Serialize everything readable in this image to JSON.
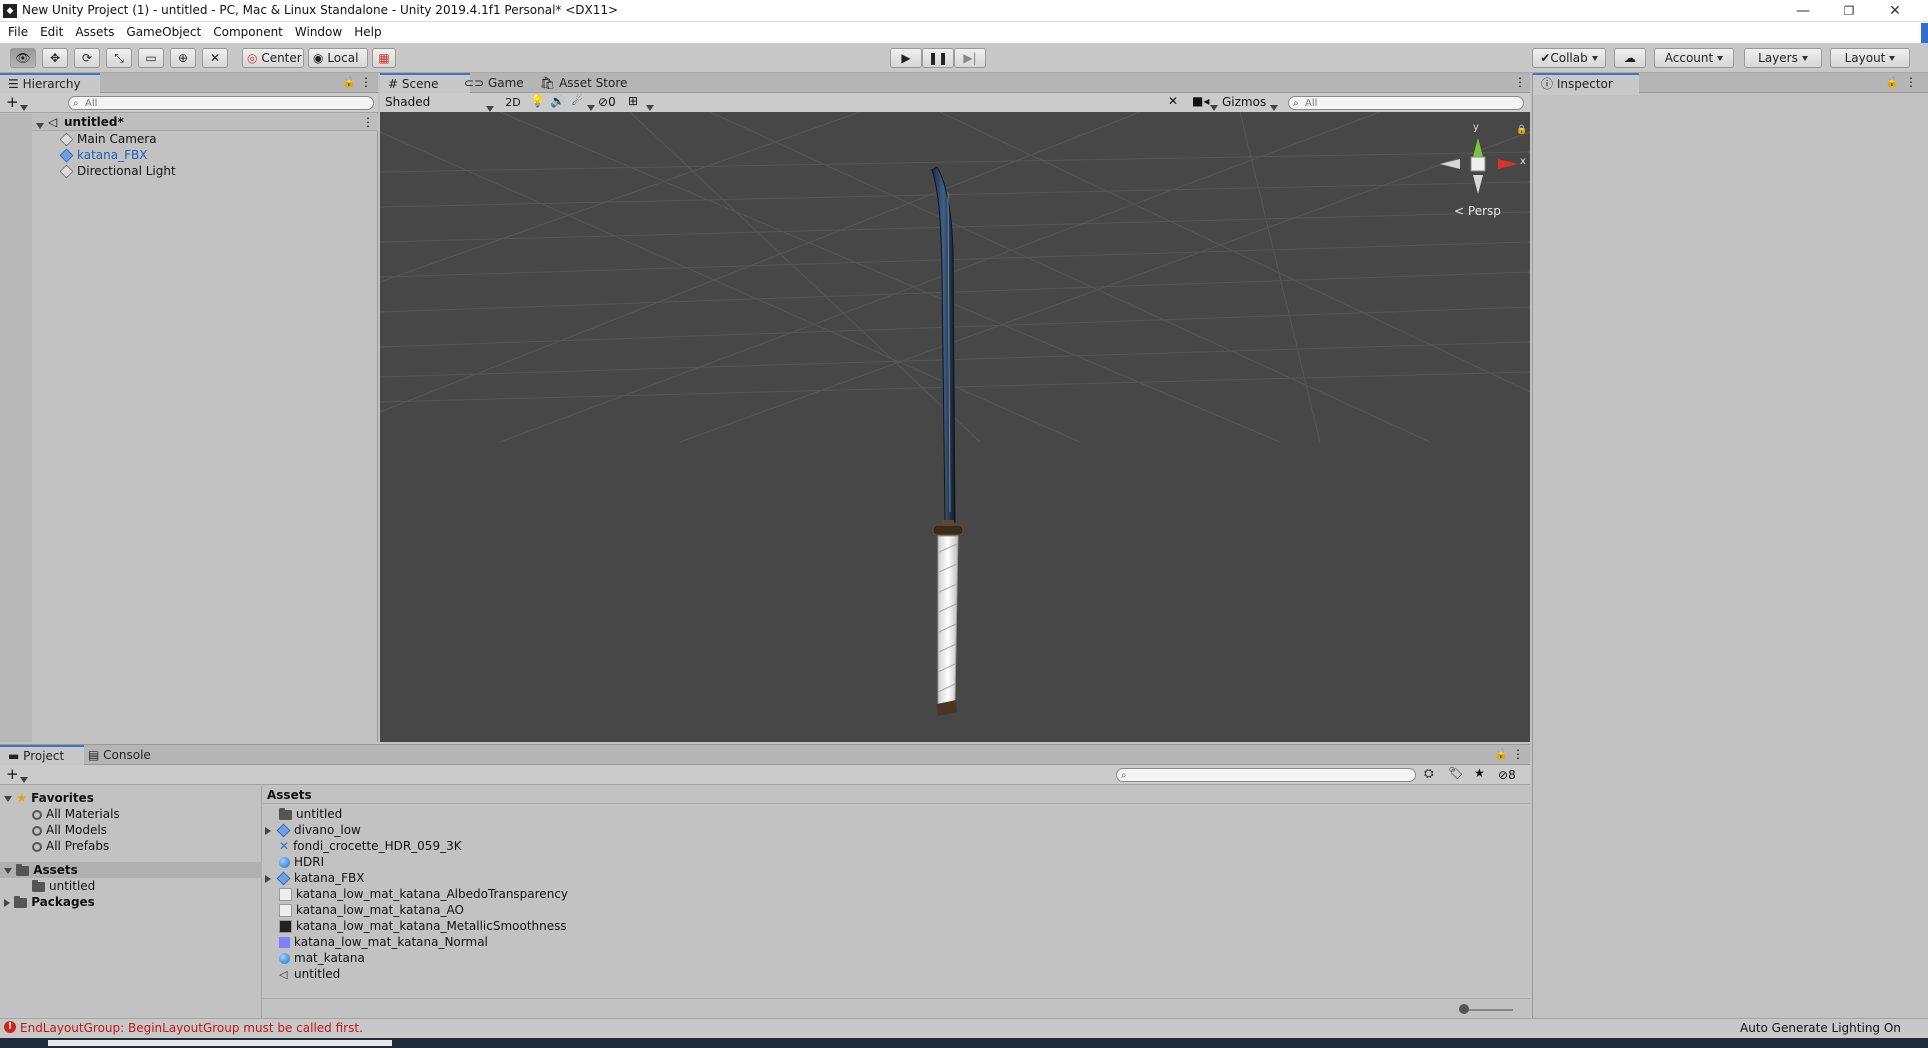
{
  "window": {
    "title": "New Unity Project (1) - untitled - PC, Mac & Linux Standalone - Unity 2019.4.1f1 Personal* <DX11>",
    "minimize": "—",
    "maximize": "❐",
    "close": "✕"
  },
  "menu": [
    "File",
    "Edit",
    "Assets",
    "GameObject",
    "Component",
    "Window",
    "Help"
  ],
  "toolbar": {
    "pivot_center": "Center",
    "pivot_local": "Local",
    "collab": "Collab",
    "account": "Account",
    "layers": "Layers",
    "layout": "Layout"
  },
  "hierarchy": {
    "tab": "Hierarchy",
    "search_placeholder": "All",
    "scene_name": "untitled*",
    "items": [
      "Main Camera",
      "katana_FBX",
      "Directional Light"
    ]
  },
  "scene": {
    "tabs": [
      "Scene",
      "Game",
      "Asset Store"
    ],
    "shading_mode": "Shaded",
    "mode_2d": "2D",
    "hidden_count": "0",
    "gizmos": "Gizmos",
    "search_placeholder": "All",
    "projection": "Persp",
    "gizmo_axes": {
      "x": "x",
      "y": "y"
    }
  },
  "inspector": {
    "tab": "Inspector"
  },
  "project": {
    "tabs": [
      "Project",
      "Console"
    ],
    "favorites_label": "Favorites",
    "favorites": [
      "All Materials",
      "All Models",
      "All Prefabs"
    ],
    "assets_label": "Assets",
    "assets_children": [
      "untitled"
    ],
    "packages_label": "Packages",
    "breadcrumb": "Assets",
    "hidden_count": "8",
    "files": [
      {
        "name": "untitled",
        "icon": "folder-icon"
      },
      {
        "name": "divano_low",
        "icon": "model-icon"
      },
      {
        "name": "fondi_crocette_HDR_059_3K",
        "icon": "texture-icon"
      },
      {
        "name": "HDRI",
        "icon": "material-icon"
      },
      {
        "name": "katana_FBX",
        "icon": "model-icon"
      },
      {
        "name": "katana_low_mat_katana_AlbedoTransparency",
        "icon": "texture-icon"
      },
      {
        "name": "katana_low_mat_katana_AO",
        "icon": "texture-icon"
      },
      {
        "name": "katana_low_mat_katana_MetallicSmoothness",
        "icon": "texture-icon"
      },
      {
        "name": "katana_low_mat_katana_Normal",
        "icon": "normal-map-icon"
      },
      {
        "name": "mat_katana",
        "icon": "material-icon"
      },
      {
        "name": "untitled",
        "icon": "scene-icon"
      }
    ]
  },
  "status": {
    "error": "EndLayoutGroup: BeginLayoutGroup must be called first.",
    "lighting": "Auto Generate Lighting On"
  },
  "colors": {
    "accent_tab": "#3b78c2",
    "selected_text": "#1f5fbf",
    "error": "#d32020",
    "scene_bg": "#474747"
  }
}
